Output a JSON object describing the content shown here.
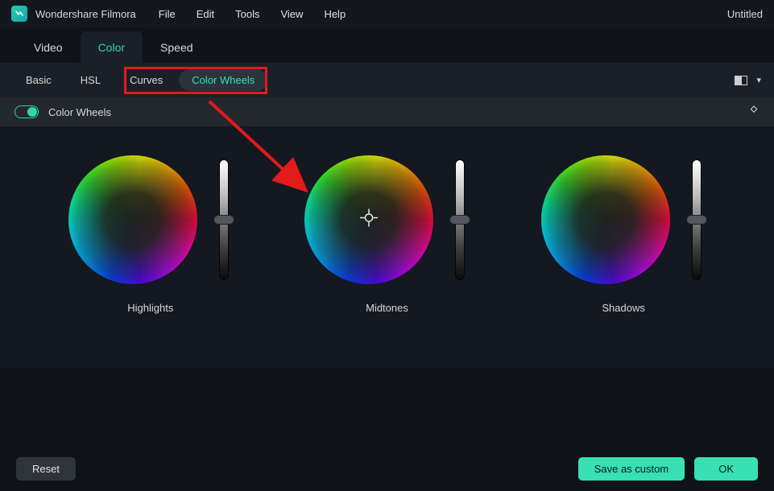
{
  "app": {
    "name": "Wondershare Filmora",
    "doc_title": "Untitled"
  },
  "menu": {
    "file": "File",
    "edit": "Edit",
    "tools": "Tools",
    "view": "View",
    "help": "Help"
  },
  "main_tabs": {
    "video": "Video",
    "color": "Color",
    "speed": "Speed",
    "active": "color"
  },
  "sub_tabs": {
    "basic": "Basic",
    "hsl": "HSL",
    "curves": "Curves",
    "color_wheels": "Color Wheels",
    "active": "color_wheels"
  },
  "section": {
    "title": "Color Wheels",
    "toggle_on": true
  },
  "wheels": {
    "highlights": {
      "label": "Highlights",
      "slider_pos": 0.5
    },
    "midtones": {
      "label": "Midtones",
      "slider_pos": 0.5,
      "show_crosshair": true
    },
    "shadows": {
      "label": "Shadows",
      "slider_pos": 0.5
    }
  },
  "footer": {
    "reset": "Reset",
    "save_custom": "Save as custom",
    "ok": "OK"
  },
  "colors": {
    "accent": "#2fd6aa",
    "annotation": "#e21b1b"
  },
  "annotation": {
    "highlight_curves_and_colorwheels": true,
    "arrow_to_midtones": true
  }
}
